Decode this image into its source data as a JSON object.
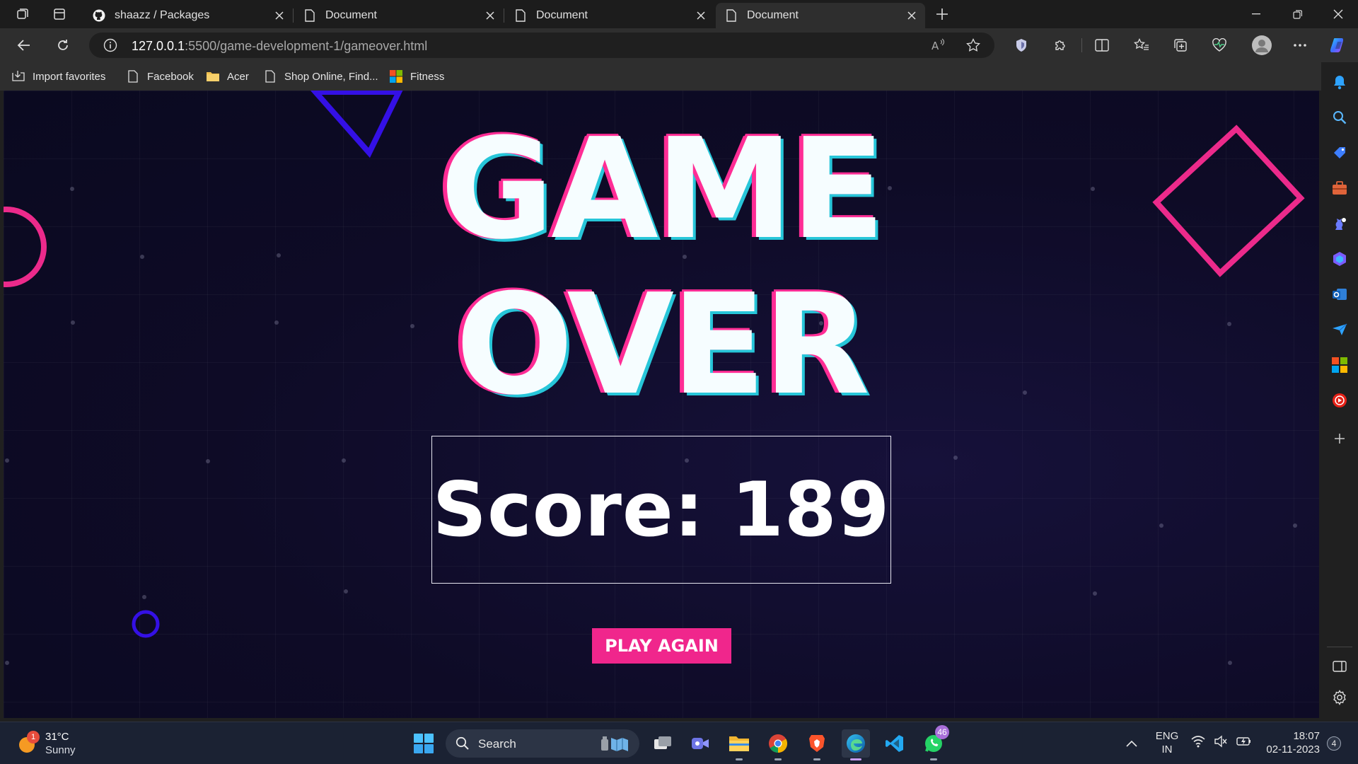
{
  "browser": {
    "tabs": [
      {
        "title": "shaazz / Packages",
        "icon": "github-icon"
      },
      {
        "title": "Document",
        "icon": "document-icon"
      },
      {
        "title": "Document",
        "icon": "document-icon"
      },
      {
        "title": "Document",
        "icon": "document-icon",
        "active": true
      }
    ],
    "address": {
      "host": "127.0.0.1",
      "path": ":5500/game-development-1/gameover.html"
    },
    "favorites": [
      {
        "label": "Import favorites",
        "icon": "import-icon"
      },
      {
        "label": "Facebook",
        "icon": "document-icon"
      },
      {
        "label": "Acer",
        "icon": "folder-icon"
      },
      {
        "label": "Shop Online, Find...",
        "icon": "document-icon"
      },
      {
        "label": "Fitness",
        "icon": "microsoft-icon"
      }
    ]
  },
  "game": {
    "title_line1": "GAME",
    "title_line2": "OVER",
    "score_text": "Score: 189",
    "play_again_label": "PLAY AGAIN",
    "colors": {
      "accent": "#f0268c",
      "shape_blue": "#3410e6",
      "shadow_cyan": "#27c6d9",
      "background": "#0e0b26"
    }
  },
  "taskbar": {
    "weather": {
      "temp": "31°C",
      "condition": "Sunny",
      "alert_count": "1"
    },
    "search_label": "Search",
    "whatsapp_badge": "46",
    "language": {
      "line1": "ENG",
      "line2": "IN"
    },
    "time": "18:07",
    "date": "02-11-2023",
    "notification_count": "4"
  }
}
